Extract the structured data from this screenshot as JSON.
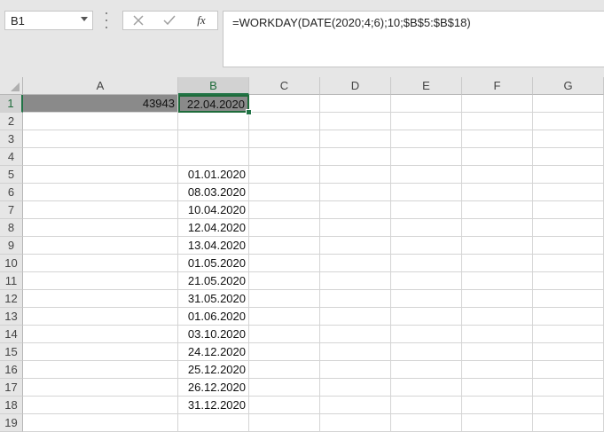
{
  "name_box": {
    "value": "B1"
  },
  "formula_bar": {
    "cancel_icon": "x-icon",
    "enter_icon": "check-icon",
    "fx_label": "fx",
    "formula": "=WORKDAY(DATE(2020;4;6);10;$B$5:$B$18)"
  },
  "columns": [
    "A",
    "B",
    "C",
    "D",
    "E",
    "F",
    "G"
  ],
  "rows": [
    "1",
    "2",
    "3",
    "4",
    "5",
    "6",
    "7",
    "8",
    "9",
    "10",
    "11",
    "12",
    "13",
    "14",
    "15",
    "16",
    "17",
    "18",
    "19"
  ],
  "cells": {
    "A1": "43943",
    "B1": "22.04.2020",
    "B5": "01.01.2020",
    "B6": "08.03.2020",
    "B7": "10.04.2020",
    "B8": "12.04.2020",
    "B9": "13.04.2020",
    "B10": "01.05.2020",
    "B11": "21.05.2020",
    "B12": "31.05.2020",
    "B13": "01.06.2020",
    "B14": "03.10.2020",
    "B15": "24.12.2020",
    "B16": "25.12.2020",
    "B17": "26.12.2020",
    "B18": "31.12.2020"
  },
  "selected_cell": "B1",
  "colors": {
    "selection": "#217346",
    "highlight_fill": "#8a8a8a"
  }
}
